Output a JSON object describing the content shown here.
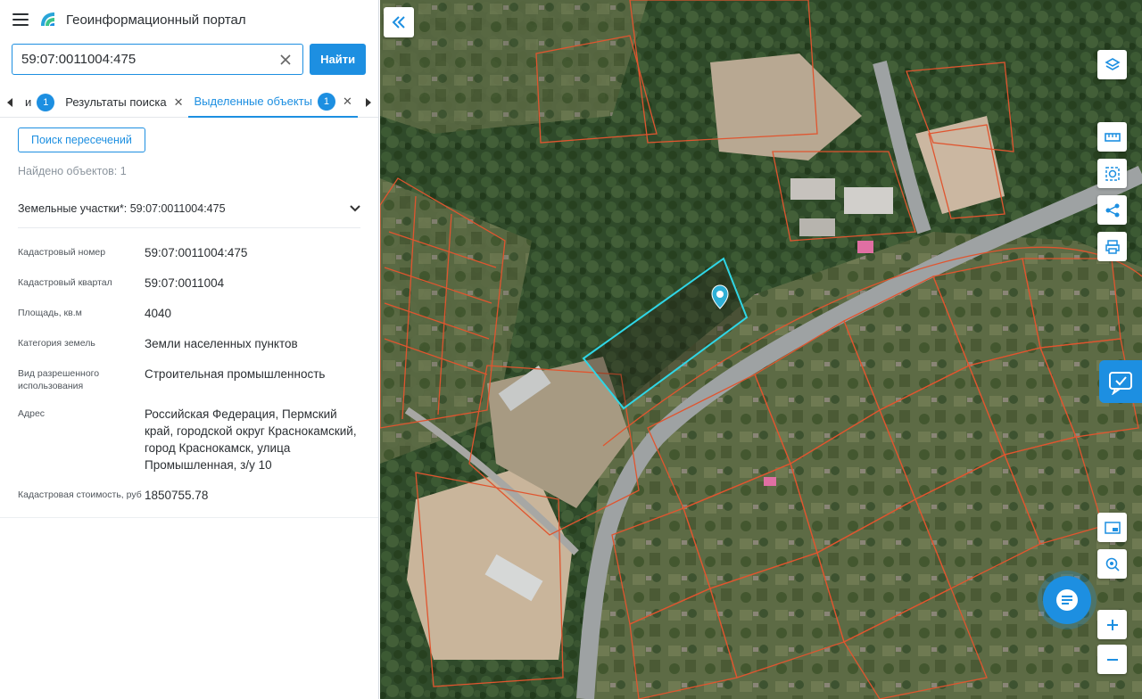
{
  "header": {
    "title": "Геоинформационный портал"
  },
  "search": {
    "value": "59:07:0011004:475",
    "find_label": "Найти"
  },
  "tabs": [
    {
      "label": "и",
      "badge": "1"
    },
    {
      "label": "Результаты поиска"
    },
    {
      "label": "Выделенные объекты",
      "badge": "1",
      "active": true
    }
  ],
  "results": {
    "intersect_label": "Поиск пересечений",
    "found_text": "Найдено объектов: 1",
    "section_title": "Земельные участки*: 59:07:0011004:475"
  },
  "properties": [
    {
      "label": "Кадастровый номер",
      "value": "59:07:0011004:475"
    },
    {
      "label": "Кадастровый квартал",
      "value": "59:07:0011004"
    },
    {
      "label": "Площадь, кв.м",
      "value": "4040"
    },
    {
      "label": "Категория земель",
      "value": "Земли населенных пунктов"
    },
    {
      "label": "Вид разрешенного использования",
      "value": "Строительная промышленность"
    },
    {
      "label": "Адрес",
      "value": "Российская Федерация, Пермский край, городской округ Краснокамский, город Краснокамск, улица Промышленная, з/у 10"
    },
    {
      "label": "Кадастровая стоимость, руб",
      "value": "1850755.78"
    }
  ],
  "colors": {
    "accent": "#1d8fe1",
    "parcel_outline": "#e0552f",
    "selected_outline": "#2fd6e6"
  },
  "map_tools": [
    "layers-icon",
    "ruler-icon",
    "select-area-icon",
    "share-icon",
    "print-icon",
    "minimap-icon",
    "locate-icon",
    "zoom-in-icon",
    "zoom-out-icon"
  ]
}
